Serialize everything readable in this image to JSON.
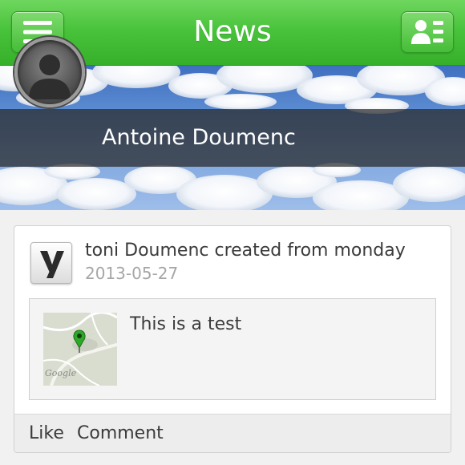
{
  "header": {
    "title": "News",
    "menu_icon": "menu-icon",
    "contacts_icon": "contacts-icon"
  },
  "profile": {
    "name": "Antoine Doumenc",
    "avatar_icon": "avatar-silhouette-icon"
  },
  "post": {
    "app_icon": "yammer-logo",
    "author_line": "toni Doumenc created from monday",
    "date": "2013-05-27",
    "attachment": {
      "thumbnail": "map-thumbnail",
      "map_watermark": "Google",
      "text": "This is a test"
    },
    "actions": {
      "like": "Like",
      "comment": "Comment"
    }
  },
  "colors": {
    "header_green": "#48c23a",
    "banner_sky": "#5a8ad0",
    "text": "#3b3b3b",
    "muted_text": "#a6a6a6",
    "map_pin": "#2fa82a"
  }
}
